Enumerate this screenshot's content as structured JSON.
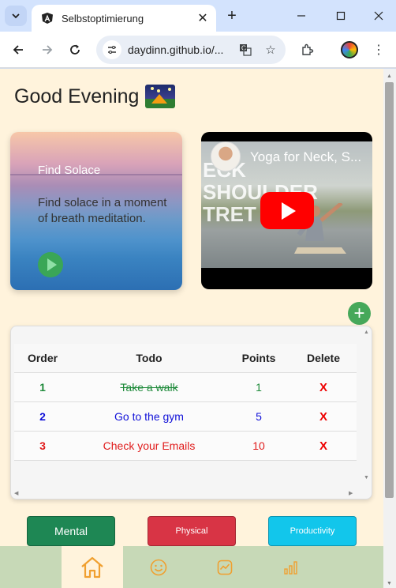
{
  "browser": {
    "tab_title": "Selbstoptimierung",
    "url": "daydinn.github.io/..."
  },
  "page": {
    "greeting": "Good Evening",
    "card": {
      "title": "Find Solace",
      "text": "Find solace in a moment of breath meditation."
    },
    "video": {
      "title": "Yoga for Neck, S...",
      "overlay_lines": [
        "ECK",
        "SHOULDER",
        "TRET"
      ]
    },
    "add_label": "+",
    "table": {
      "headers": [
        "Order",
        "Todo",
        "Points",
        "Delete"
      ],
      "rows": [
        {
          "order": "1",
          "todo": "Take a walk",
          "points": "1",
          "delete": "X",
          "color": "#1e8a3a",
          "done": true
        },
        {
          "order": "2",
          "todo": "Go to the gym",
          "points": "5",
          "delete": "X",
          "color": "#1010d8",
          "done": false
        },
        {
          "order": "3",
          "todo": "Check your Emails",
          "points": "10",
          "delete": "X",
          "color": "#e01b1b",
          "done": false
        }
      ]
    },
    "categories": [
      {
        "label": "Mental",
        "color": "#1e8754"
      },
      {
        "label": "Physical",
        "color": "#d83445"
      },
      {
        "label": "Productivity",
        "color": "#12c6eb"
      }
    ],
    "bottom_nav": [
      {
        "name": "home-icon",
        "active": true
      },
      {
        "name": "smiley-icon",
        "active": false
      },
      {
        "name": "chart-line-icon",
        "active": false
      },
      {
        "name": "bar-chart-icon",
        "active": false
      }
    ],
    "accent_color": "#f0a030"
  }
}
